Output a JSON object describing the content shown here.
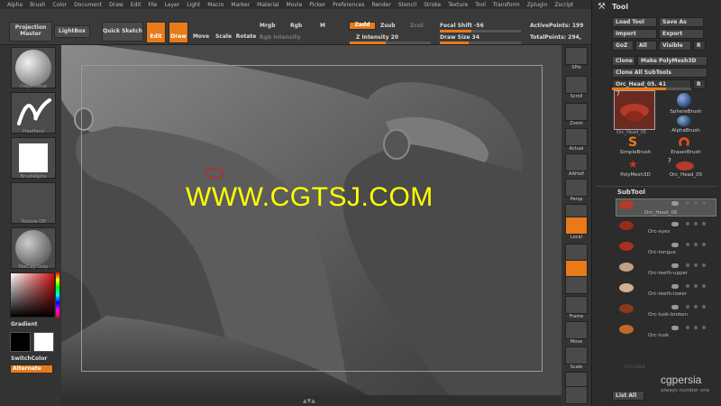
{
  "menu": [
    "Alpha",
    "Brush",
    "Color",
    "Document",
    "Draw",
    "Edit",
    "File",
    "Layer",
    "Light",
    "Macro",
    "Marker",
    "Material",
    "Movie",
    "Picker",
    "Preferences",
    "Render",
    "Stencil",
    "Stroke",
    "Texture",
    "Tool",
    "Transform",
    "Zplugin",
    "Zscript"
  ],
  "toolbar": {
    "projection_master": "Projection Master",
    "lightbox": "LightBox",
    "quick_sketch": "Quick Sketch",
    "edit": "Edit",
    "draw": "Draw",
    "move": "Move",
    "scale": "Scale",
    "rotate": "Rotate",
    "mrgb": "Mrgb",
    "rgb": "Rgb",
    "m": "M",
    "zadd": "Zadd",
    "zsub": "Zsub",
    "zcut": "Zcut",
    "rgb_intensity": "Rgb Intensity",
    "z_intensity": "Z Intensity 20",
    "focal_shift": "Focal Shift -56",
    "draw_size": "Draw Size 34",
    "active_points": "ActivePoints: 199",
    "total_points": "TotalPoints: 294,"
  },
  "left": {
    "brush": "ClayBuildup",
    "stroke": "FreeHand",
    "alpha": "BrushAlpha",
    "texture": "Texture Off",
    "material": "MatCap Gray",
    "gradient": "Gradient",
    "switchcolor": "SwitchColor",
    "alternate": "Alternate"
  },
  "shelf": [
    "SPix",
    "Scroll",
    "Zoom",
    "Actual",
    "AAHalf",
    "Persp",
    "Floor",
    "Local",
    "L.Sym",
    "xyz",
    "",
    "Frame",
    "Move",
    "Scale",
    "Rotate",
    ""
  ],
  "watermark": "WWW.CGTSJ.COM",
  "tool": {
    "title": "Tool",
    "load_tool": "Load Tool",
    "save_as": "Save As",
    "import": "Import",
    "export": "Export",
    "goz": "GoZ",
    "all": "All",
    "visible": "Visible",
    "r": "R",
    "clone": "Clone",
    "make_polymesh": "Make PolyMesh3D",
    "clone_all": "Clone All SubTools",
    "current": "Orc_Head_05. 41",
    "r2": "R",
    "thumbs": [
      {
        "label": "Orc_Head_05",
        "count": "7"
      },
      {
        "label": "SphereBrush",
        "count": ""
      },
      {
        "label": "",
        "count": ""
      },
      {
        "label": "AlphaBrush",
        "count": ""
      },
      {
        "label": "SimpleBrush",
        "count": ""
      },
      {
        "label": "EraserBrush",
        "count": ""
      },
      {
        "label": "PolyMesh3D",
        "count": ""
      },
      {
        "label": "Orc_Head_05",
        "count": "7"
      }
    ],
    "subtool_title": "SubTool",
    "subtools": [
      "Orc_Head_06",
      "Orc-eyes",
      "Orc-tongue",
      "Orc-teeth-upper",
      "Orc-teeth-lower",
      "Orc-tusk-broken",
      "Orc-tusk"
    ],
    "unused": "Unused",
    "list_all": "List All",
    "logo": "cgpersia",
    "logo_sub": "always number one"
  },
  "colors": {
    "accent": "#e87a1a",
    "watermark": "#ffff00"
  }
}
